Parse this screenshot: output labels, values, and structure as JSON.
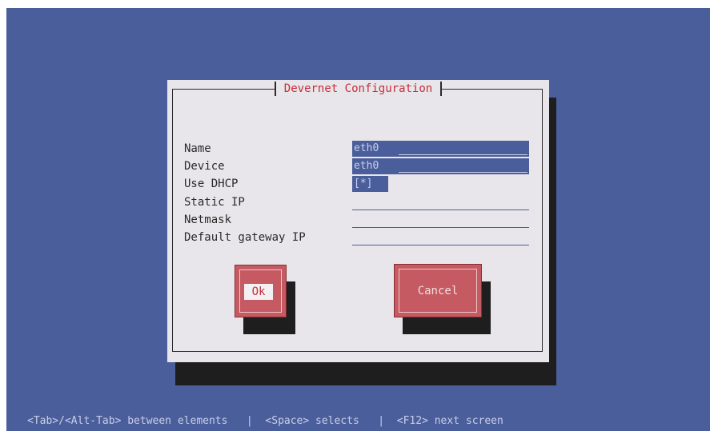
{
  "dialog": {
    "title": "Devernet Configuration",
    "fields": [
      {
        "label": "Name",
        "value": "eth0"
      },
      {
        "label": "Device",
        "value": "eth0"
      },
      {
        "label": "Use DHCP",
        "value": "[*]"
      },
      {
        "label": "Static IP",
        "value": ""
      },
      {
        "label": "Netmask",
        "value": ""
      },
      {
        "label": "Default gateway IP",
        "value": ""
      }
    ],
    "buttons": {
      "ok": "Ok",
      "cancel": "Cancel"
    }
  },
  "statusbar": {
    "text": "<Tab>/<Alt-Tab> between elements   |  <Space> selects   |  <F12> next screen"
  },
  "colors": {
    "background": "#4b5e9c",
    "dialog": "#e8e6ea",
    "title": "#c42f3a",
    "button": "#c65a62",
    "shadow": "#1e1e1e"
  }
}
